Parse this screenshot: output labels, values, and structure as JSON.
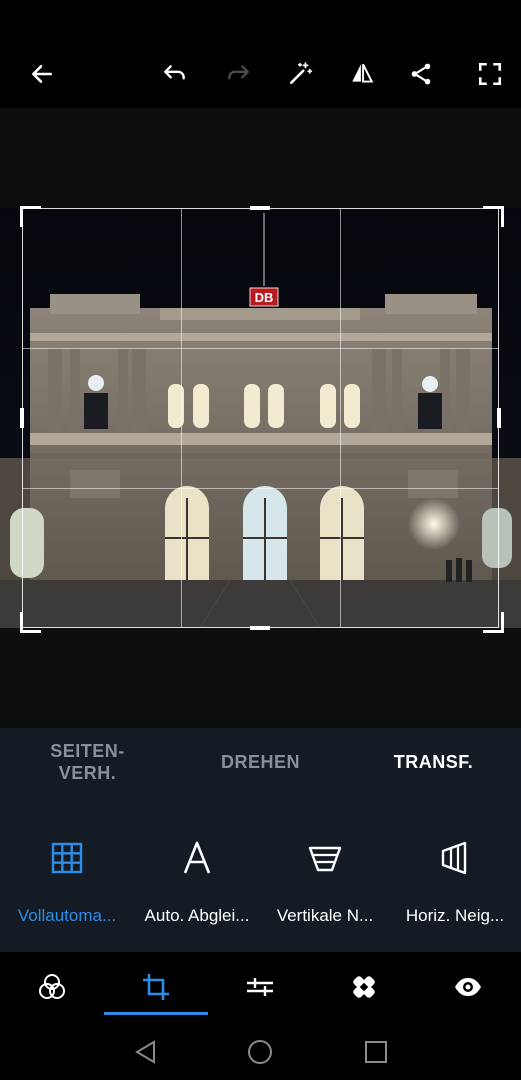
{
  "colors": {
    "accent": "#2d8ce6",
    "tab_inactive": "#8a9099",
    "panel_bg": "#141b24"
  },
  "topbar": {
    "icons": [
      "back-arrow-icon",
      "undo-icon",
      "redo-icon",
      "magic-wand-icon",
      "compare-icon",
      "share-icon",
      "fullscreen-icon"
    ]
  },
  "tabs": [
    {
      "label": "SEITEN-\nVERH.",
      "active": false
    },
    {
      "label": "DREHEN",
      "active": false
    },
    {
      "label": "TRANSF.",
      "active": true
    }
  ],
  "tools": [
    {
      "label": "Vollautoma...",
      "icon": "grid-icon",
      "active": true
    },
    {
      "label": "Auto. Abglei...",
      "icon": "letter-a-icon",
      "active": false
    },
    {
      "label": "Vertikale N...",
      "icon": "vertical-perspective-icon",
      "active": false
    },
    {
      "label": "Horiz. Neig...",
      "icon": "horizontal-perspective-icon",
      "active": false
    }
  ],
  "bottom_nav": {
    "items": [
      "looks-icon",
      "crop-icon",
      "adjustments-icon",
      "healing-icon",
      "eye-icon"
    ],
    "active_index": 1
  },
  "photo": {
    "sign_text": "DB"
  }
}
